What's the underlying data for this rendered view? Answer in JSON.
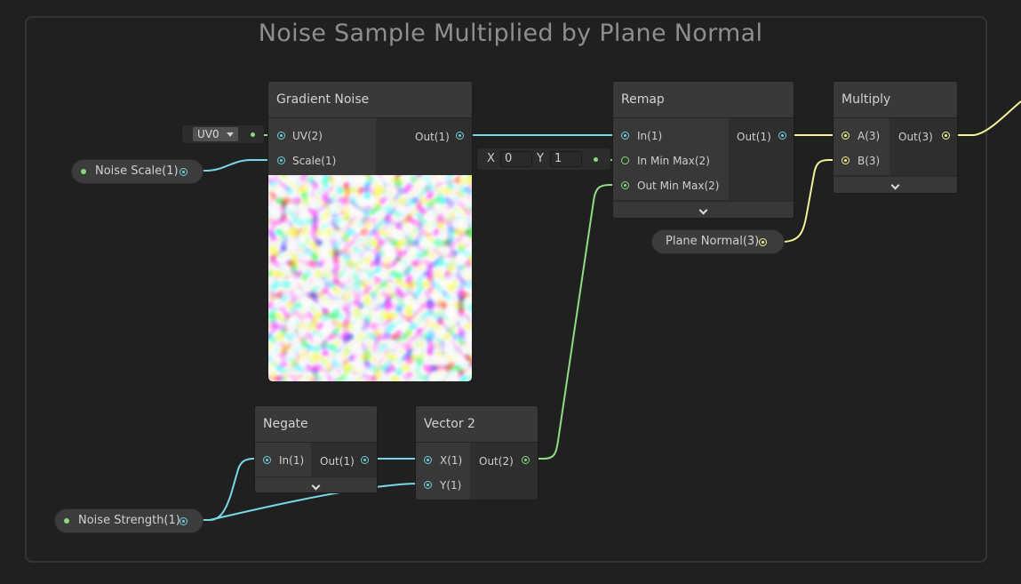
{
  "group": {
    "title": "Noise Sample Multiplied by Plane Normal"
  },
  "gradient_noise": {
    "title": "Gradient Noise",
    "inputs": [
      "UV(2)",
      "Scale(1)"
    ],
    "output": "Out(1)",
    "uv_default": "UV0"
  },
  "remap": {
    "title": "Remap",
    "inputs": [
      "In(1)",
      "In Min Max(2)",
      "Out Min Max(2)"
    ],
    "output": "Out(1)",
    "in_min_max": {
      "x_label": "X",
      "x_value": "0",
      "y_label": "Y",
      "y_value": "1"
    }
  },
  "multiply": {
    "title": "Multiply",
    "inputs": [
      "A(3)",
      "B(3)"
    ],
    "output": "Out(3)"
  },
  "negate": {
    "title": "Negate",
    "inputs": [
      "In(1)"
    ],
    "output": "Out(1)"
  },
  "vector2": {
    "title": "Vector 2",
    "inputs": [
      "X(1)",
      "Y(1)"
    ],
    "output": "Out(2)"
  },
  "properties": {
    "noise_scale": "Noise Scale(1)",
    "plane_normal": "Plane Normal(3)",
    "noise_strength": "Noise Strength(1)"
  },
  "colors": {
    "float_wire": "#79d8e6",
    "vector2_wire": "#8fdc85",
    "vector3_wire": "#f4f29a",
    "background": "#202020"
  }
}
